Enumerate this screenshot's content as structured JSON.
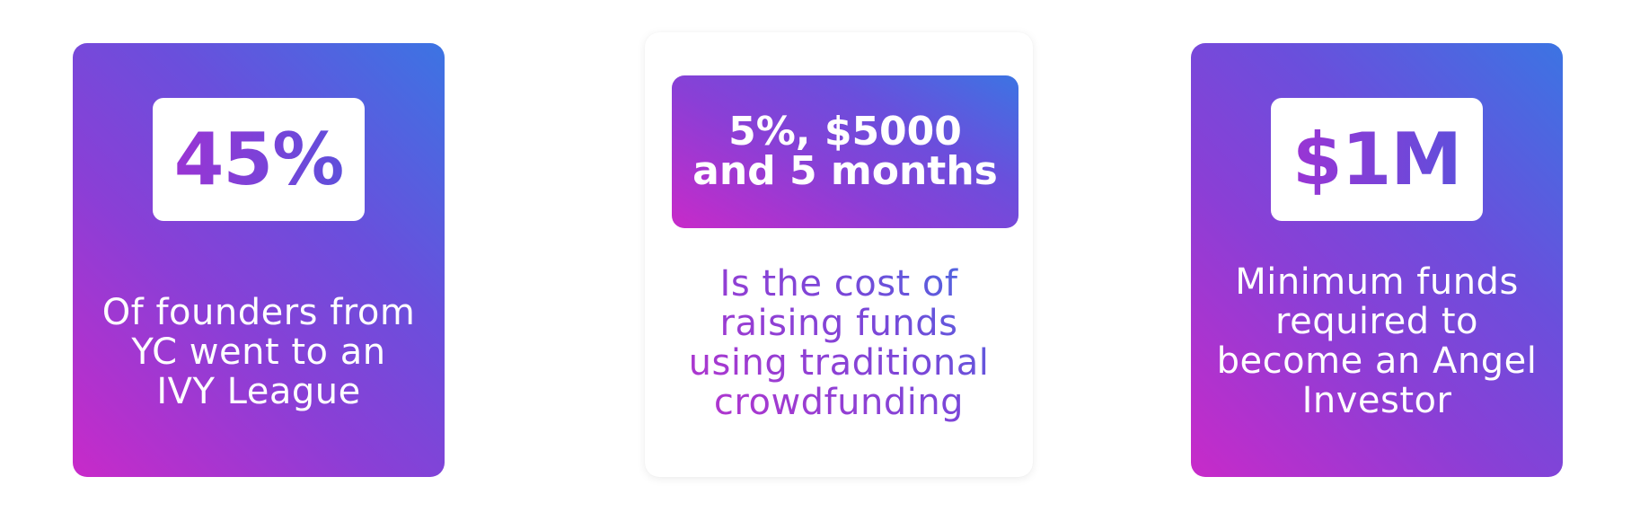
{
  "cards": [
    {
      "stat": "45%",
      "description_lines": [
        "Of founders from",
        "YC went to an",
        "IVY League"
      ]
    },
    {
      "banner_lines": [
        "5%, $5000",
        "and 5 months"
      ],
      "description_lines": [
        "Is the cost of",
        "raising funds",
        "using traditional",
        "crowdfunding"
      ]
    },
    {
      "stat": "$1M",
      "description_lines": [
        "Minimum funds",
        "required to",
        "become an Angel",
        "Investor"
      ]
    }
  ],
  "colors": {
    "gradient_pink": "#c82ac9",
    "gradient_purple": "#6a4fdc",
    "gradient_blue": "#3c74e3",
    "background": "#ffffff"
  }
}
